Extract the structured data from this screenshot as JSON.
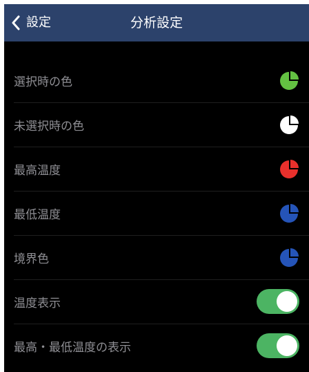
{
  "nav": {
    "back_label": "設定",
    "title": "分析設定"
  },
  "rows": [
    {
      "label": "選択時の色",
      "type": "color",
      "color": "#63c142",
      "icon": "pie-chart-icon"
    },
    {
      "label": "未選択時の色",
      "type": "color",
      "color": "#ffffff",
      "icon": "pie-chart-icon"
    },
    {
      "label": "最高温度",
      "type": "color",
      "color": "#e8302c",
      "icon": "pie-chart-icon"
    },
    {
      "label": "最低温度",
      "type": "color",
      "color": "#2554b8",
      "icon": "pie-chart-icon"
    },
    {
      "label": "境界色",
      "type": "color",
      "color": "#2554b8",
      "icon": "pie-chart-icon"
    },
    {
      "label": "温度表示",
      "type": "toggle",
      "on": true,
      "color": "#4cb463"
    },
    {
      "label": "最高・最低温度の表示",
      "type": "toggle",
      "on": true,
      "color": "#4cb463"
    }
  ],
  "colors": {
    "navbar": "#2c426b",
    "background": "#000000",
    "label": "#8e8e93"
  }
}
